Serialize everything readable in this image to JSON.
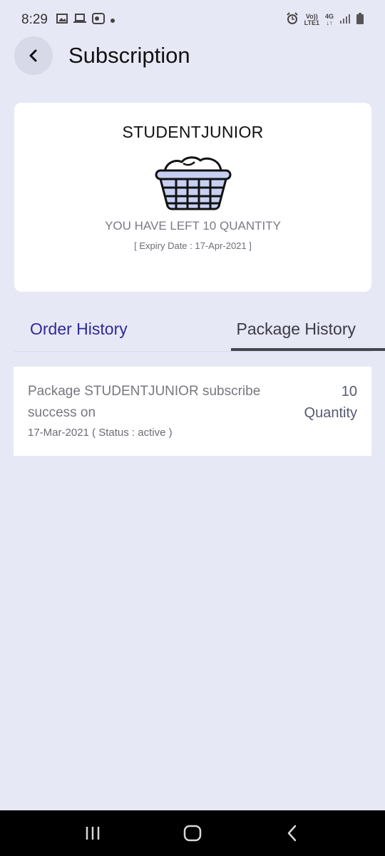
{
  "status_bar": {
    "time": "8:29",
    "volte_label": "Vo))",
    "lte_label": "LTE1",
    "network_label": "4G"
  },
  "header": {
    "title": "Subscription"
  },
  "card": {
    "plan_name": "STUDENTJUNIOR",
    "left_quantity": "YOU HAVE LEFT 10 QUANTITY",
    "expiry": "[ Expiry Date : 17-Apr-2021 ]",
    "icon": "laundry-basket-icon"
  },
  "tabs": [
    {
      "label": "Order History",
      "active": false
    },
    {
      "label": "Package History",
      "active": true
    }
  ],
  "history": [
    {
      "description": "Package STUDENTJUNIOR subscribe success on",
      "date_status": "17-Mar-2021 ( Status : active )",
      "quantity": "10",
      "quantity_label": "Quantity"
    }
  ],
  "colors": {
    "background": "#e7e8f5",
    "active_tab_text": "#2d2a9a",
    "indicator": "#444650"
  }
}
